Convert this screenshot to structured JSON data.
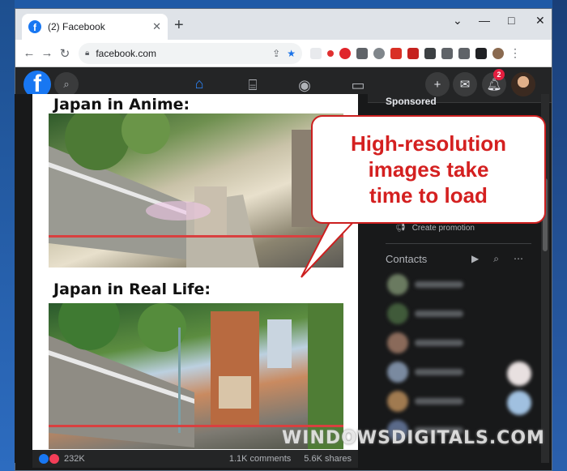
{
  "browser": {
    "tab_title": "(2) Facebook",
    "address": "facebook.com",
    "new_tab": "+",
    "minimize": "—",
    "maximize": "□",
    "close": "✕"
  },
  "facebook": {
    "notifications_badge": "2",
    "post": {
      "heading_top": "Japan in Anime:",
      "heading_bottom": "Japan in Real Life:",
      "reactions": "232K",
      "comments": "1.1K comments",
      "shares": "5.6K shares"
    },
    "sidebar": {
      "sponsored": "Sponsored",
      "create_promotion": "Create promotion",
      "contacts": "Contacts"
    }
  },
  "callout": {
    "lines": [
      "High-resolution",
      "images take",
      "time to load"
    ]
  },
  "watermark": "WINDOWSDIGITALS.COM",
  "colors": {
    "fb_blue": "#1877f2",
    "callout_red": "#d42020",
    "badge_red": "#e41e3f"
  }
}
